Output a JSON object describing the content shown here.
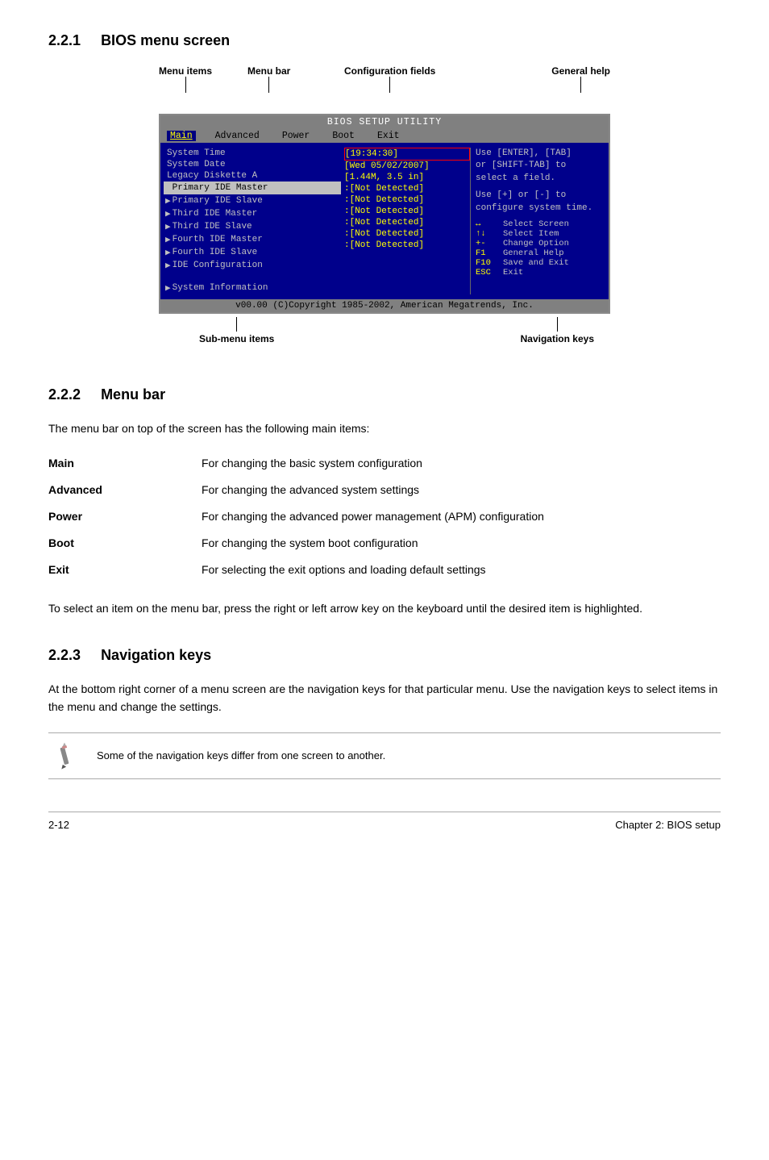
{
  "section221": {
    "number": "2.2.1",
    "title": "BIOS menu screen",
    "labels": {
      "menu_items": "Menu items",
      "menu_bar": "Menu bar",
      "config_fields": "Configuration fields",
      "general_help": "General help",
      "sub_menu_items": "Sub-menu items",
      "navigation_keys": "Navigation keys"
    },
    "bios": {
      "title": "BIOS SETUP UTILITY",
      "menu_bar": [
        "Main",
        "Advanced",
        "Power",
        "Boot",
        "Exit"
      ],
      "menu_active": "Main",
      "left_items": [
        {
          "type": "sys",
          "text": "System Time"
        },
        {
          "type": "sys",
          "text": "System Date"
        },
        {
          "type": "sys",
          "text": "Legacy Diskette A"
        },
        {
          "type": "ide",
          "text": "Primary IDE Master",
          "highlighted": true
        },
        {
          "type": "ide",
          "text": "Primary IDE Slave"
        },
        {
          "type": "ide",
          "text": "Third IDE Master"
        },
        {
          "type": "ide",
          "text": "Third IDE Slave"
        },
        {
          "type": "ide",
          "text": "Fourth IDE Master"
        },
        {
          "type": "ide",
          "text": "Fourth IDE Slave"
        },
        {
          "type": "ide",
          "text": "IDE Configuration"
        },
        {
          "type": "ide",
          "text": "System Information",
          "bottom": true
        }
      ],
      "center_items": [
        {
          "text": "[19:34:30]",
          "type": "sys"
        },
        {
          "text": "[Wed 05/02/2007]",
          "type": "sys"
        },
        {
          "text": "[1.44M, 3.5 in]",
          "type": "sys"
        },
        {
          "text": ":[Not Detected]",
          "type": "ide"
        },
        {
          "text": ":[Not Detected]",
          "type": "ide"
        },
        {
          "text": ":[Not Detected]",
          "type": "ide"
        },
        {
          "text": ":[Not Detected]",
          "type": "ide"
        },
        {
          "text": ":[Not Detected]",
          "type": "ide"
        },
        {
          "text": ":[Not Detected]",
          "type": "ide"
        }
      ],
      "help_text": [
        "Use [ENTER], [TAB]",
        "or [SHIFT-TAB] to",
        "select a field.",
        "",
        "Use [+] or [-] to",
        "configure system time."
      ],
      "nav_keys": [
        {
          "sym": "↔",
          "desc": "Select Screen"
        },
        {
          "sym": "↑↓",
          "desc": "Select Item"
        },
        {
          "sym": "+-",
          "desc": "Change Option"
        },
        {
          "sym": "F1",
          "desc": "General Help"
        },
        {
          "sym": "F10",
          "desc": "Save and Exit"
        },
        {
          "sym": "ESC",
          "desc": "Exit"
        }
      ],
      "footer": "v00.00 (C)Copyright 1985-2002, American Megatrends, Inc."
    }
  },
  "section222": {
    "number": "2.2.2",
    "title": "Menu bar",
    "intro": "The menu bar on top of the screen has the following main items:",
    "items": [
      {
        "name": "Main",
        "desc": "For changing the basic system configuration"
      },
      {
        "name": "Advanced",
        "desc": "For changing the advanced system settings"
      },
      {
        "name": "Power",
        "desc": "For changing the advanced power management (APM) configuration"
      },
      {
        "name": "Boot",
        "desc": "For changing the system boot configuration"
      },
      {
        "name": "Exit",
        "desc": "For selecting the exit options and loading default settings"
      }
    ],
    "note": "To select an item on the menu bar, press the right or left arrow key on the keyboard until the desired item is highlighted."
  },
  "section223": {
    "number": "2.2.3",
    "title": "Navigation keys",
    "intro": "At the bottom right corner of a menu screen are the navigation keys for that particular menu. Use the navigation keys to select items in the menu and change the settings.",
    "note_text": "Some of the navigation keys differ from one screen to another."
  },
  "footer": {
    "page_number": "2-12",
    "chapter": "Chapter 2: BIOS setup"
  }
}
